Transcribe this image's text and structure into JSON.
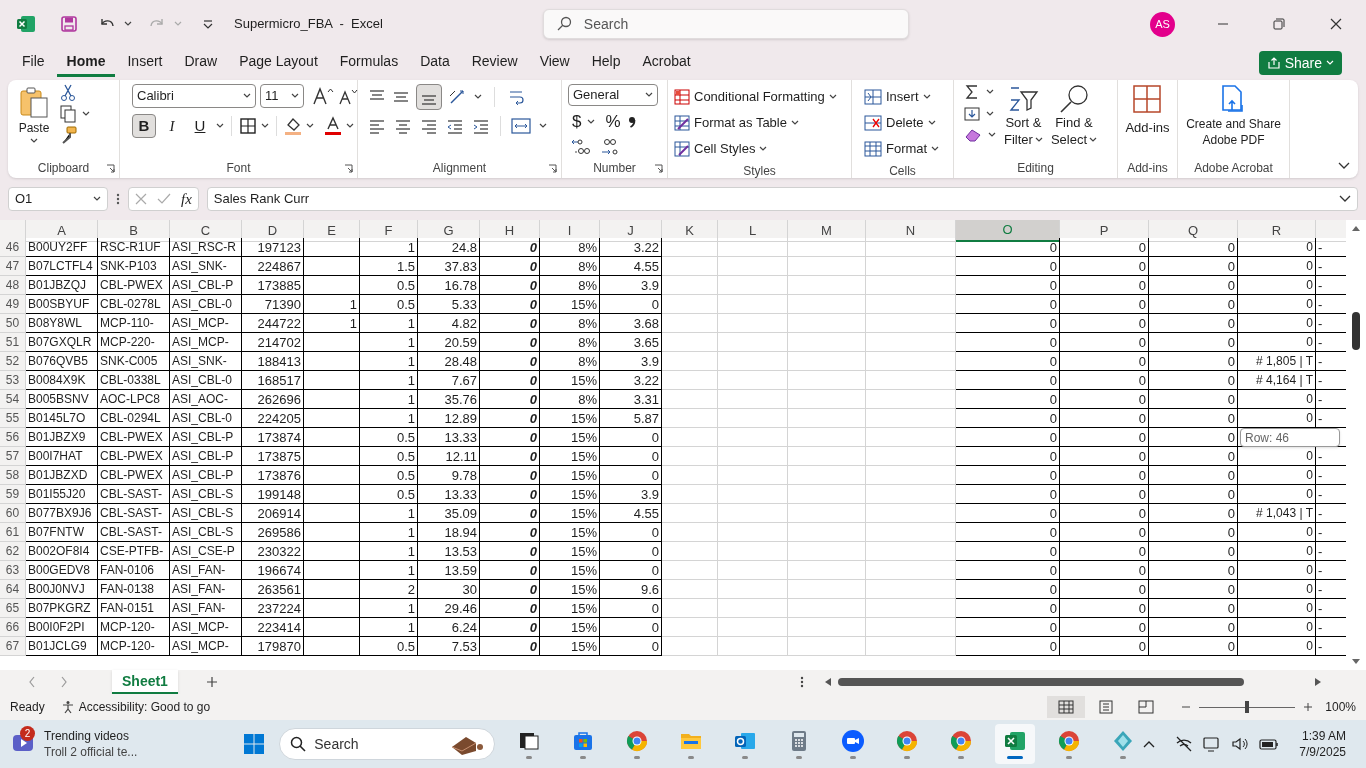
{
  "title_bar": {
    "title": "Supermicro_FBA  -  Excel",
    "search_placeholder": "Search",
    "account_initials": "AS"
  },
  "menu_tabs": [
    {
      "label": "File",
      "selected": false
    },
    {
      "label": "Home",
      "selected": true
    },
    {
      "label": "Insert",
      "selected": false
    },
    {
      "label": "Draw",
      "selected": false
    },
    {
      "label": "Page Layout",
      "selected": false
    },
    {
      "label": "Formulas",
      "selected": false
    },
    {
      "label": "Data",
      "selected": false
    },
    {
      "label": "Review",
      "selected": false
    },
    {
      "label": "View",
      "selected": false
    },
    {
      "label": "Help",
      "selected": false
    },
    {
      "label": "Acrobat",
      "selected": false
    }
  ],
  "share_button": "Share",
  "ribbon": {
    "clipboard": {
      "paste": "Paste",
      "label": "Clipboard"
    },
    "font": {
      "name": "Calibri",
      "size": "11",
      "styles": [
        {
          "label": "B",
          "kind": "bold",
          "selected": true
        },
        {
          "label": "I",
          "kind": "italic",
          "selected": false
        },
        {
          "label": "U",
          "kind": "underline",
          "selected": false
        }
      ],
      "label": "Font"
    },
    "alignment": {
      "bottom_align_selected": true,
      "label": "Alignment"
    },
    "number": {
      "format": "General",
      "symbols": [
        "$",
        "%"
      ],
      "label": "Number"
    },
    "styles": {
      "items": [
        "Conditional Formatting",
        "Format as Table",
        "Cell Styles"
      ],
      "label": "Styles"
    },
    "cells": {
      "items": [
        "Insert",
        "Delete",
        "Format"
      ],
      "label": "Cells"
    },
    "editing": {
      "sort": [
        "Sort &",
        "Filter"
      ],
      "find": [
        "Find &",
        "Select"
      ],
      "label": "Editing"
    },
    "addins": {
      "button": "Add-ins",
      "label": "Add-ins"
    },
    "acrobat": {
      "button": [
        "Create and Share",
        "Adobe PDF"
      ],
      "label": "Adobe Acrobat"
    }
  },
  "formula_bar": {
    "name_box": "O1",
    "fx": "fx",
    "formula": "Sales Rank Curr"
  },
  "columns": [
    {
      "label": "A",
      "selected": false
    },
    {
      "label": "B",
      "selected": false
    },
    {
      "label": "C",
      "selected": false
    },
    {
      "label": "D",
      "selected": false
    },
    {
      "label": "E",
      "selected": false
    },
    {
      "label": "F",
      "selected": false
    },
    {
      "label": "G",
      "selected": false
    },
    {
      "label": "H",
      "selected": false
    },
    {
      "label": "I",
      "selected": false
    },
    {
      "label": "J",
      "selected": false
    },
    {
      "label": "K",
      "selected": false
    },
    {
      "label": "L",
      "selected": false
    },
    {
      "label": "M",
      "selected": false
    },
    {
      "label": "N",
      "selected": false
    },
    {
      "label": "O",
      "selected": true
    },
    {
      "label": "P",
      "selected": false
    },
    {
      "label": "Q",
      "selected": false
    },
    {
      "label": "R",
      "selected": false
    }
  ],
  "rows": [
    {
      "number": "46",
      "cells": [
        "B00UY2FF",
        "RSC-R1UF",
        "ASI_RSC-R",
        "197123",
        null,
        "1",
        "24.8",
        "0",
        "8%",
        "3.22",
        null,
        null,
        null,
        null,
        "0",
        "0",
        "0",
        "0",
        "-"
      ]
    },
    {
      "number": "47",
      "cells": [
        "B07LCTFL4",
        "SNK-P103",
        "ASI_SNK-",
        "224867",
        null,
        "1.5",
        "37.83",
        "0",
        "8%",
        "4.55",
        null,
        null,
        null,
        null,
        "0",
        "0",
        "0",
        "0",
        "-"
      ]
    },
    {
      "number": "48",
      "cells": [
        "B01JBZQJ",
        "CBL-PWEX",
        "ASI_CBL-P",
        "173885",
        null,
        "0.5",
        "16.78",
        "0",
        "8%",
        "3.9",
        null,
        null,
        null,
        null,
        "0",
        "0",
        "0",
        "0",
        "-"
      ]
    },
    {
      "number": "49",
      "cells": [
        "B00SBYUF",
        "CBL-0278L",
        "ASI_CBL-0",
        "71390",
        "1",
        "0.5",
        "5.33",
        "0",
        "15%",
        "0",
        null,
        null,
        null,
        null,
        "0",
        "0",
        "0",
        "0",
        "-"
      ]
    },
    {
      "number": "50",
      "cells": [
        "B08Y8WL",
        "MCP-110-",
        "ASI_MCP-",
        "244722",
        "1",
        "1",
        "4.82",
        "0",
        "8%",
        "3.68",
        null,
        null,
        null,
        null,
        "0",
        "0",
        "0",
        "0",
        "-"
      ]
    },
    {
      "number": "51",
      "cells": [
        "B07GXQLR",
        "MCP-220-",
        "ASI_MCP-",
        "214702",
        null,
        "1",
        "20.59",
        "0",
        "8%",
        "3.65",
        null,
        null,
        null,
        null,
        "0",
        "0",
        "0",
        "0",
        "-"
      ]
    },
    {
      "number": "52",
      "cells": [
        "B076QVB5",
        "SNK-C005",
        "ASI_SNK-",
        "188413",
        null,
        "1",
        "28.48",
        "0",
        "8%",
        "3.9",
        null,
        null,
        null,
        null,
        "0",
        "0",
        "0",
        "# 1,805 | T",
        "-"
      ]
    },
    {
      "number": "53",
      "cells": [
        "B0084X9K",
        "CBL-0338L",
        "ASI_CBL-0",
        "168517",
        null,
        "1",
        "7.67",
        "0",
        "15%",
        "3.22",
        null,
        null,
        null,
        null,
        "0",
        "0",
        "0",
        "# 4,164 | T",
        "-"
      ]
    },
    {
      "number": "54",
      "cells": [
        "B005BSNV",
        "AOC-LPC8",
        "ASI_AOC-",
        "262696",
        null,
        "1",
        "35.76",
        "0",
        "8%",
        "3.31",
        null,
        null,
        null,
        null,
        "0",
        "0",
        "0",
        "0",
        "-"
      ]
    },
    {
      "number": "55",
      "cells": [
        "B0145L7O",
        "CBL-0294L",
        "ASI_CBL-0",
        "224205",
        null,
        "1",
        "12.89",
        "0",
        "15%",
        "5.87",
        null,
        null,
        null,
        null,
        "0",
        "0",
        "0",
        "0",
        "-"
      ]
    },
    {
      "number": "56",
      "cells": [
        "B01JBZX9",
        "CBL-PWEX",
        "ASI_CBL-P",
        "173874",
        null,
        "0.5",
        "13.33",
        "0",
        "15%",
        "0",
        null,
        null,
        null,
        null,
        "0",
        "0",
        "0",
        null,
        null
      ]
    },
    {
      "number": "57",
      "cells": [
        "B00I7HAT",
        "CBL-PWEX",
        "ASI_CBL-P",
        "173875",
        null,
        "0.5",
        "12.11",
        "0",
        "15%",
        "0",
        null,
        null,
        null,
        null,
        "0",
        "0",
        "0",
        "0",
        "-"
      ]
    },
    {
      "number": "58",
      "cells": [
        "B01JBZXD",
        "CBL-PWEX",
        "ASI_CBL-P",
        "173876",
        null,
        "0.5",
        "9.78",
        "0",
        "15%",
        "0",
        null,
        null,
        null,
        null,
        "0",
        "0",
        "0",
        "0",
        "-"
      ]
    },
    {
      "number": "59",
      "cells": [
        "B01I55J20",
        "CBL-SAST-",
        "ASI_CBL-S",
        "199148",
        null,
        "0.5",
        "13.33",
        "0",
        "15%",
        "3.9",
        null,
        null,
        null,
        null,
        "0",
        "0",
        "0",
        "0",
        "-"
      ]
    },
    {
      "number": "60",
      "cells": [
        "B077BX9J6",
        "CBL-SAST-",
        "ASI_CBL-S",
        "206914",
        null,
        "1",
        "35.09",
        "0",
        "15%",
        "4.55",
        null,
        null,
        null,
        null,
        "0",
        "0",
        "0",
        "# 1,043 | T",
        "-"
      ]
    },
    {
      "number": "61",
      "cells": [
        "B07FNTW",
        "CBL-SAST-",
        "ASI_CBL-S",
        "269586",
        null,
        "1",
        "18.94",
        "0",
        "15%",
        "0",
        null,
        null,
        null,
        null,
        "0",
        "0",
        "0",
        "0",
        "-"
      ]
    },
    {
      "number": "62",
      "cells": [
        "B002OF8I4",
        "CSE-PTFB-",
        "ASI_CSE-P",
        "230322",
        null,
        "1",
        "13.53",
        "0",
        "15%",
        "0",
        null,
        null,
        null,
        null,
        "0",
        "0",
        "0",
        "0",
        "-"
      ]
    },
    {
      "number": "63",
      "cells": [
        "B00GEDV8",
        "FAN-0106",
        "ASI_FAN-",
        "196674",
        null,
        "1",
        "13.59",
        "0",
        "15%",
        "0",
        null,
        null,
        null,
        null,
        "0",
        "0",
        "0",
        "0",
        "-"
      ]
    },
    {
      "number": "64",
      "cells": [
        "B00J0NVJ",
        "FAN-0138",
        "ASI_FAN-",
        "263561",
        null,
        "2",
        "30",
        "0",
        "15%",
        "9.6",
        null,
        null,
        null,
        null,
        "0",
        "0",
        "0",
        "0",
        "-"
      ]
    },
    {
      "number": "65",
      "cells": [
        "B07PKGRZ",
        "FAN-0151",
        "ASI_FAN-",
        "237224",
        null,
        "1",
        "29.46",
        "0",
        "15%",
        "0",
        null,
        null,
        null,
        null,
        "0",
        "0",
        "0",
        "0",
        "-"
      ]
    },
    {
      "number": "66",
      "cells": [
        "B00I0F2PI",
        "MCP-120-",
        "ASI_MCP-",
        "223414",
        null,
        "1",
        "6.24",
        "0",
        "15%",
        "0",
        null,
        null,
        null,
        null,
        "0",
        "0",
        "0",
        "0",
        "-"
      ]
    },
    {
      "number": "67",
      "cells": [
        "B01JCLG9",
        "MCP-120-",
        "ASI_MCP-",
        "179870",
        null,
        "0.5",
        "7.53",
        "0",
        "15%",
        "0",
        null,
        null,
        null,
        null,
        "0",
        "0",
        "0",
        "0",
        "-"
      ]
    }
  ],
  "tooltip": "Row: 46",
  "sheet_tabs": [
    {
      "label": "Sheet1",
      "selected": true
    }
  ],
  "status_bar": {
    "ready": "Ready",
    "accessibility": "Accessibility: Good to go",
    "views": [
      {
        "kind": "normal",
        "selected": true
      },
      {
        "kind": "layout",
        "selected": false
      },
      {
        "kind": "break",
        "selected": false
      }
    ],
    "zoom": {
      "level": 0.5
    },
    "zoom_label": "100%"
  },
  "taskbar": {
    "widget": {
      "badge": "2",
      "title": "Trending videos",
      "subtitle": "Troll 2 official te..."
    },
    "search": "Search",
    "apps": [
      {
        "kind": "taskview",
        "selected": false
      },
      {
        "kind": "store",
        "selected": false
      },
      {
        "kind": "chrome",
        "selected": false
      },
      {
        "kind": "folder",
        "selected": false
      },
      {
        "kind": "outlook",
        "selected": false
      },
      {
        "kind": "calculator",
        "selected": false
      },
      {
        "kind": "zoom",
        "selected": false
      },
      {
        "kind": "chrome",
        "selected": false
      },
      {
        "kind": "chrome",
        "selected": false
      },
      {
        "kind": "excel",
        "selected": true
      },
      {
        "kind": "chrome",
        "selected": false
      },
      {
        "kind": "gem",
        "selected": false
      }
    ],
    "time": "1:39 AM",
    "date": "7/9/2025"
  }
}
